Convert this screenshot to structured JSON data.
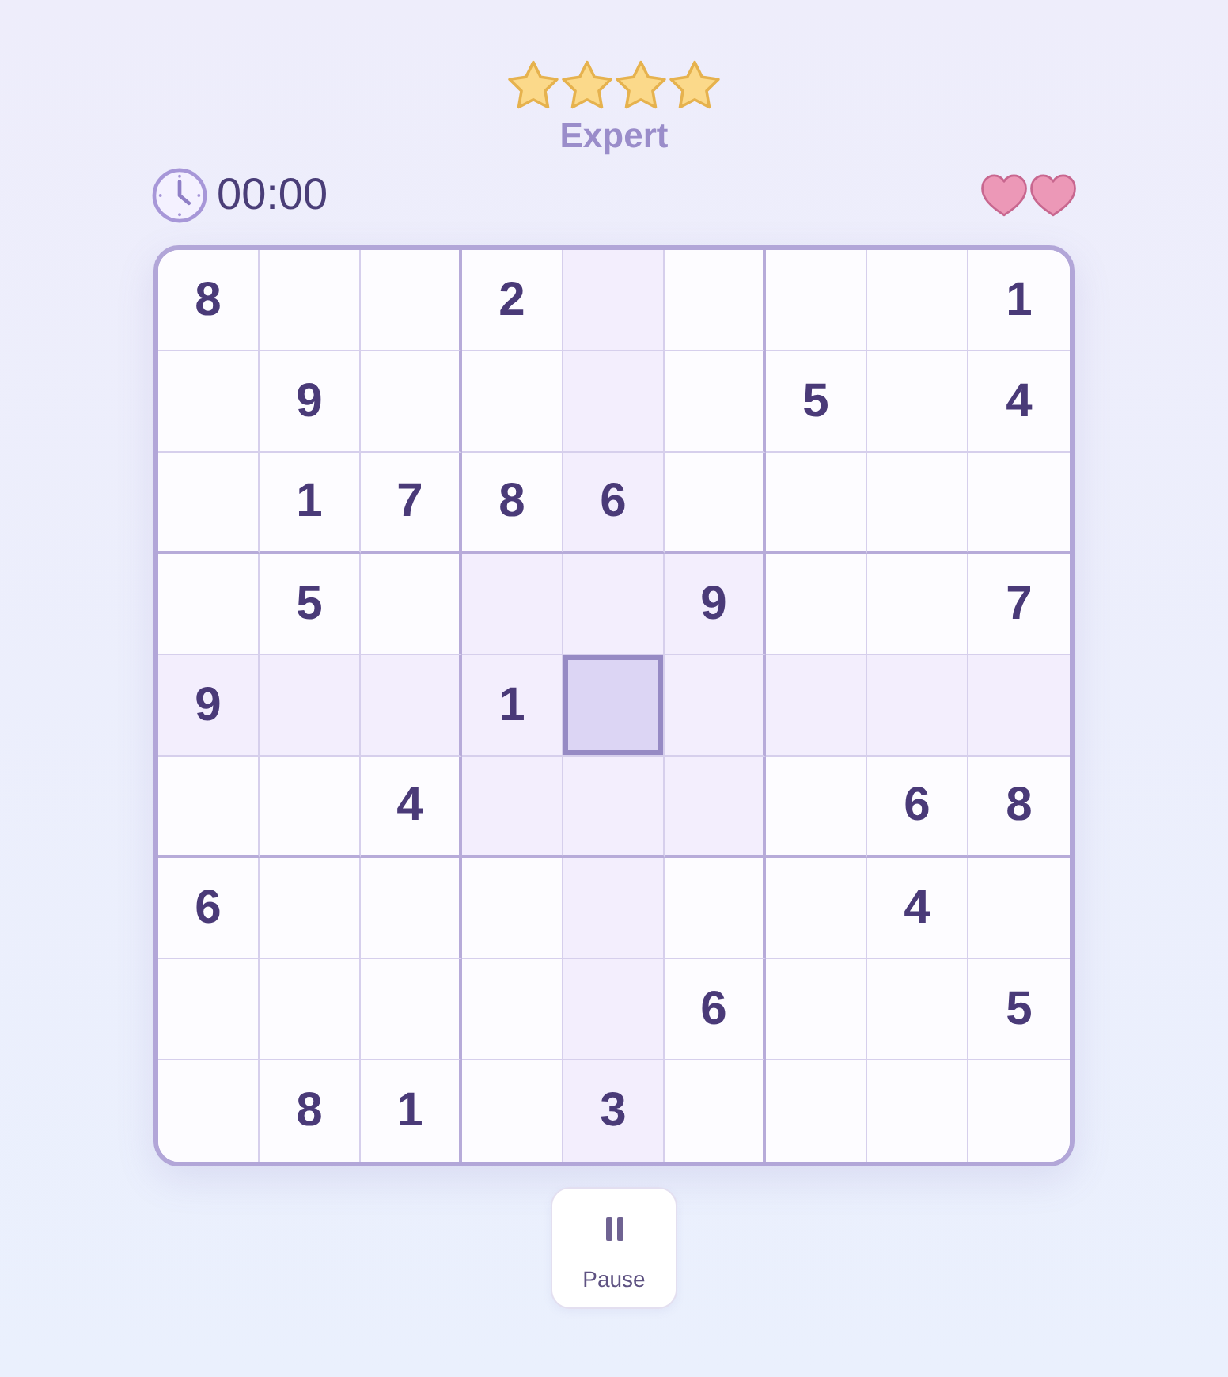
{
  "difficulty": {
    "stars": 4,
    "label": "Expert"
  },
  "timer": {
    "time": "00:00"
  },
  "lives": [
    {
      "lost": false
    },
    {
      "lost": false
    }
  ],
  "board": {
    "rows": [
      [
        {
          "value": "8",
          "selected": false
        },
        {
          "selected": false
        },
        {
          "selected": false
        },
        {
          "value": "2",
          "selected": false
        },
        {
          "selected": false
        },
        {
          "selected": false
        },
        {
          "selected": false
        },
        {
          "selected": false
        },
        {
          "value": "1",
          "selected": false
        }
      ],
      [
        {
          "selected": false
        },
        {
          "value": "9",
          "selected": false
        },
        {
          "selected": false
        },
        {
          "selected": false
        },
        {
          "selected": false
        },
        {
          "selected": false
        },
        {
          "value": "5",
          "selected": false
        },
        {
          "selected": false
        },
        {
          "value": "4",
          "selected": false
        }
      ],
      [
        {
          "selected": false
        },
        {
          "value": "1",
          "selected": false
        },
        {
          "value": "7",
          "selected": false
        },
        {
          "value": "8",
          "selected": false
        },
        {
          "value": "6",
          "selected": false
        },
        {
          "selected": false
        },
        {
          "selected": false
        },
        {
          "selected": false
        },
        {
          "selected": false
        }
      ],
      [
        {
          "selected": false
        },
        {
          "value": "5",
          "selected": false
        },
        {
          "selected": false
        },
        {
          "selected": false
        },
        {
          "selected": false
        },
        {
          "value": "9",
          "selected": false
        },
        {
          "selected": false
        },
        {
          "selected": false
        },
        {
          "value": "7",
          "selected": false
        }
      ],
      [
        {
          "value": "9",
          "selected": false
        },
        {
          "selected": false
        },
        {
          "selected": false
        },
        {
          "value": "1",
          "selected": false
        },
        {
          "selected": true
        },
        {
          "selected": false
        },
        {
          "selected": false
        },
        {
          "selected": false
        },
        {
          "selected": false
        }
      ],
      [
        {
          "selected": false
        },
        {
          "selected": false
        },
        {
          "value": "4",
          "selected": false
        },
        {
          "selected": false
        },
        {
          "selected": false
        },
        {
          "selected": false
        },
        {
          "selected": false
        },
        {
          "value": "6",
          "selected": false
        },
        {
          "value": "8",
          "selected": false
        }
      ],
      [
        {
          "value": "6",
          "selected": false
        },
        {
          "selected": false
        },
        {
          "selected": false
        },
        {
          "selected": false
        },
        {
          "selected": false
        },
        {
          "selected": false
        },
        {
          "selected": false
        },
        {
          "value": "4",
          "selected": false
        },
        {
          "selected": false
        }
      ],
      [
        {
          "selected": false
        },
        {
          "selected": false
        },
        {
          "selected": false
        },
        {
          "selected": false
        },
        {
          "selected": false
        },
        {
          "value": "6",
          "selected": false
        },
        {
          "selected": false
        },
        {
          "selected": false
        },
        {
          "value": "5",
          "selected": false
        }
      ],
      [
        {
          "selected": false
        },
        {
          "value": "8",
          "selected": false
        },
        {
          "value": "1",
          "selected": false
        },
        {
          "selected": false
        },
        {
          "value": "3",
          "selected": false
        },
        {
          "selected": false
        },
        {
          "selected": false
        },
        {
          "selected": false
        },
        {
          "selected": false
        }
      ]
    ]
  },
  "pause_button": {
    "label": "Pause"
  }
}
